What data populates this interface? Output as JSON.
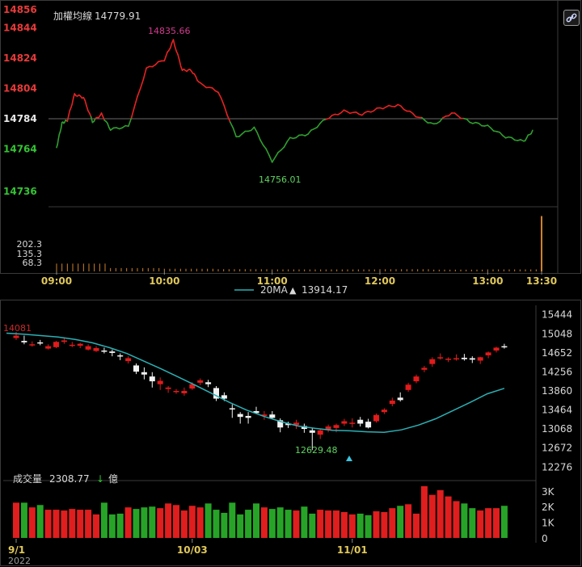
{
  "intraday": {
    "title": "加權均線",
    "index_value": "14779.91",
    "high_label": "14835.66",
    "low_label": "14756.01",
    "reference": 14784,
    "y_range": [
      14728,
      14856
    ],
    "y_ticks": [
      {
        "value": 14856,
        "label": "14856",
        "color": "#e83a3a"
      },
      {
        "value": 14844,
        "label": "14844",
        "color": "#e83a3a"
      },
      {
        "value": 14824,
        "label": "14824",
        "color": "#e83a3a"
      },
      {
        "value": 14804,
        "label": "14804",
        "color": "#e83a3a"
      },
      {
        "value": 14784,
        "label": "14784",
        "color": "#e8e8e8"
      },
      {
        "value": 14764,
        "label": "14764",
        "color": "#34c334"
      },
      {
        "value": 14736,
        "label": "14736",
        "color": "#34c334"
      }
    ],
    "x_ticks": [
      "09:00",
      "10:00",
      "11:00",
      "12:00",
      "13:00",
      "13:30"
    ],
    "volume_ticks": [
      "202.3",
      "135.3",
      "68.3"
    ],
    "up_color": "#e52222",
    "down_color": "#2f9e2f",
    "volume_color": "#d0812a",
    "link_icon": "link-icon"
  },
  "daily": {
    "ma_label": "20MA",
    "ma_arrow": "▲",
    "ma_value": "13914.17",
    "prev_high_label": "14081",
    "low_label": "12629.48",
    "y_ticks": [
      "15444",
      "15048",
      "14652",
      "14256",
      "13860",
      "13464",
      "13068",
      "12672",
      "12276"
    ],
    "x_ticks": [
      "9/1",
      "10/03",
      "11/01"
    ],
    "year_label": "2022",
    "volume_title": "成交量",
    "volume_value": "2308.77",
    "volume_arrow": "↓",
    "volume_unit": "億",
    "volume_ticks": [
      "3K",
      "2K",
      "1K",
      "0"
    ],
    "ma_color": "#2bb0b5",
    "up_color": "#e11b1b",
    "down_color": "#f2f2f2",
    "vol_up_color": "#e01e1e",
    "vol_down_color": "#27a427"
  },
  "chart_data": [
    {
      "type": "line",
      "title": "加權均線",
      "x": [
        "09:00",
        "09:03",
        "09:06",
        "09:10",
        "09:15",
        "09:20",
        "09:25",
        "09:30",
        "09:40",
        "09:50",
        "10:00",
        "10:05",
        "10:10",
        "10:15",
        "10:20",
        "10:30",
        "10:40",
        "10:50",
        "11:00",
        "11:10",
        "11:20",
        "11:30",
        "11:40",
        "11:50",
        "12:00",
        "12:10",
        "12:20",
        "12:30",
        "12:40",
        "12:50",
        "13:00",
        "13:10",
        "13:20",
        "13:25"
      ],
      "series": [
        {
          "values": [
            14765,
            14781,
            14783,
            14800,
            14798,
            14782,
            14787,
            14777,
            14779,
            14817,
            14823,
            14835.66,
            14816,
            14816,
            14807,
            14802,
            14772,
            14778,
            14756.01,
            14771,
            14774,
            14784,
            14789,
            14787,
            14791,
            14793,
            14786,
            14780,
            14788,
            14782,
            14779,
            14772,
            14769,
            14776
          ]
        }
      ],
      "ylim": [
        14736,
        14856
      ]
    },
    {
      "type": "bar",
      "categories": [
        "09:00",
        "09:30",
        "10:00",
        "10:30",
        "11:00",
        "11:30",
        "12:00",
        "12:30",
        "13:00",
        "13:30"
      ],
      "series": [
        {
          "values": [
            35,
            15,
            12,
            10,
            9,
            9,
            10,
            8,
            9,
            250
          ]
        }
      ],
      "ylim": [
        0,
        270
      ]
    },
    {
      "type": "candlestick",
      "x_ticks": [
        "9/1",
        "10/03",
        "11/01"
      ],
      "series": [
        {
          "ohlc": [
            [
              14960,
              15085,
              14920,
              15010
            ],
            [
              14900,
              15010,
              14830,
              14870
            ],
            [
              14830,
              14890,
              14780,
              14830
            ],
            [
              14870,
              14920,
              14810,
              14860
            ],
            [
              14740,
              14830,
              14720,
              14790
            ],
            [
              14770,
              14900,
              14750,
              14880
            ],
            [
              14880,
              14960,
              14840,
              14910
            ],
            [
              14820,
              14880,
              14770,
              14820
            ],
            [
              14800,
              14860,
              14750,
              14840
            ],
            [
              14720,
              14830,
              14700,
              14790
            ],
            [
              14690,
              14790,
              14670,
              14750
            ],
            [
              14700,
              14760,
              14640,
              14690
            ],
            [
              14680,
              14720,
              14580,
              14650
            ],
            [
              14600,
              14640,
              14500,
              14580
            ],
            [
              14480,
              14580,
              14430,
              14540
            ],
            [
              14390,
              14430,
              14210,
              14260
            ],
            [
              14250,
              14350,
              14100,
              14200
            ],
            [
              14160,
              14250,
              13930,
              14060
            ],
            [
              14000,
              14140,
              13880,
              14070
            ],
            [
              13900,
              13960,
              13820,
              13930
            ],
            [
              13860,
              13900,
              13800,
              13860
            ],
            [
              13810,
              13930,
              13760,
              13860
            ],
            [
              13910,
              14040,
              13880,
              14000
            ],
            [
              14030,
              14120,
              13980,
              14080
            ],
            [
              14040,
              14090,
              13940,
              14000
            ],
            [
              13920,
              13960,
              13650,
              13700
            ],
            [
              13770,
              13830,
              13650,
              13700
            ],
            [
              13500,
              13580,
              13300,
              13480
            ],
            [
              13380,
              13420,
              13180,
              13320
            ],
            [
              13340,
              13420,
              13180,
              13300
            ],
            [
              13440,
              13530,
              13380,
              13400
            ],
            [
              13340,
              13440,
              13260,
              13370
            ],
            [
              13370,
              13440,
              13280,
              13300
            ],
            [
              13250,
              13290,
              13000,
              13100
            ],
            [
              13180,
              13220,
              13090,
              13150
            ],
            [
              13150,
              13260,
              13070,
              13200
            ],
            [
              13130,
              13180,
              12990,
              13070
            ],
            [
              13040,
              13080,
              12629.48,
              12990
            ],
            [
              12950,
              13070,
              12860,
              13040
            ],
            [
              13060,
              13160,
              13000,
              13120
            ],
            [
              13090,
              13180,
              13000,
              13150
            ],
            [
              13180,
              13280,
              13130,
              13230
            ],
            [
              13200,
              13290,
              13100,
              13200
            ],
            [
              13260,
              13320,
              13120,
              13180
            ],
            [
              13220,
              13280,
              13080,
              13100
            ],
            [
              13230,
              13390,
              13200,
              13360
            ],
            [
              13420,
              13500,
              13380,
              13470
            ],
            [
              13590,
              13720,
              13540,
              13660
            ],
            [
              13720,
              13830,
              13640,
              13670
            ],
            [
              13880,
              14030,
              13840,
              13990
            ],
            [
              14060,
              14200,
              14020,
              14160
            ],
            [
              14300,
              14380,
              14250,
              14340
            ],
            [
              14420,
              14560,
              14360,
              14520
            ],
            [
              14560,
              14640,
              14510,
              14560
            ],
            [
              14520,
              14560,
              14460,
              14530
            ],
            [
              14540,
              14620,
              14490,
              14540
            ],
            [
              14550,
              14630,
              14490,
              14520
            ],
            [
              14540,
              14580,
              14440,
              14510
            ],
            [
              14490,
              14570,
              14420,
              14560
            ],
            [
              14600,
              14680,
              14540,
              14660
            ],
            [
              14700,
              14780,
              14660,
              14760
            ],
            [
              14790,
              14840,
              14740,
              14780
            ]
          ]
        }
      ],
      "ma_series": [
        {
          "name": "20MA",
          "values": [
            15060,
            15040,
            15010,
            14980,
            14930,
            14860,
            14760,
            14640,
            14480,
            14320,
            14150,
            13980,
            13800,
            13620,
            13460,
            13330,
            13220,
            13130,
            13080,
            13040,
            13030,
            13010,
            13000,
            13050,
            13150,
            13280,
            13450,
            13620,
            13800,
            13914.17
          ]
        }
      ],
      "ylim": [
        12080,
        15640
      ]
    },
    {
      "type": "bar",
      "title": "成交量",
      "series": [
        {
          "values": [
            2250,
            2250,
            1950,
            2100,
            1800,
            1800,
            1750,
            1850,
            1800,
            1800,
            1500,
            2250,
            1500,
            1550,
            1950,
            1850,
            1950,
            2000,
            1900,
            2200,
            2100,
            1750,
            2050,
            1950,
            2200,
            1800,
            1600,
            2250,
            1500,
            1800,
            2200,
            1950,
            1850,
            1950,
            1800,
            1750,
            2000,
            1550,
            1800,
            1750,
            1750,
            1650,
            1500,
            1550,
            1450,
            1700,
            1650,
            1900,
            2050,
            2150,
            1550,
            3300,
            2750,
            3050,
            2650,
            2350,
            2200,
            1900,
            1750,
            1900,
            1900,
            2050
          ]
        }
      ],
      "ylim": [
        0,
        3300
      ]
    }
  ]
}
